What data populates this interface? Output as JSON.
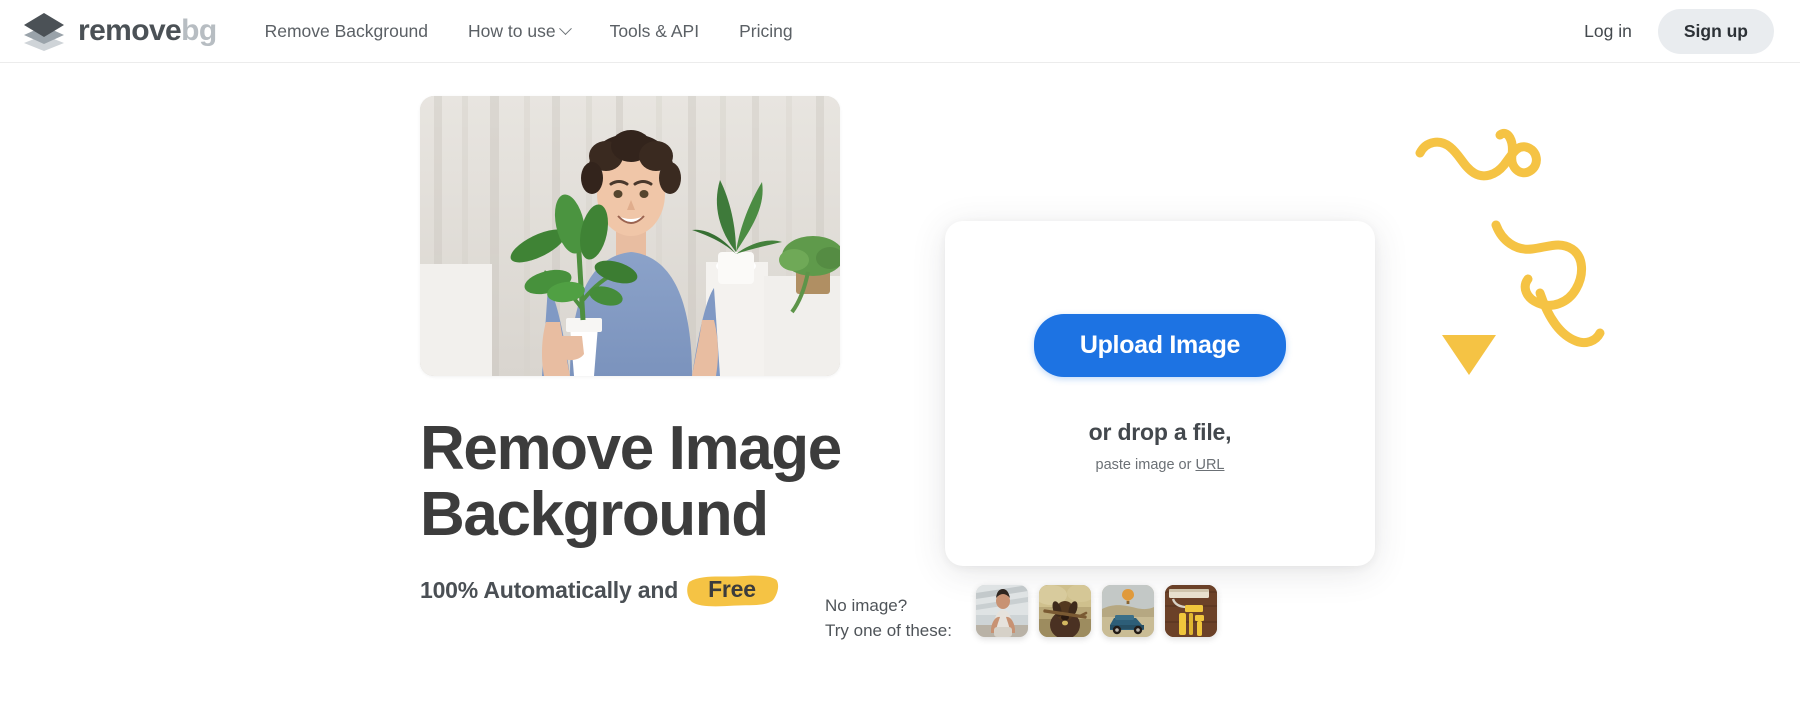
{
  "brand": {
    "name_primary": "remove",
    "name_secondary": "bg",
    "logo_icon": "stacked-layers-diamond-icon"
  },
  "header": {
    "nav": [
      {
        "label": "Remove Background",
        "has_dropdown": false
      },
      {
        "label": "How to use",
        "has_dropdown": true,
        "dropdown_icon": "chevron-down-icon"
      },
      {
        "label": "Tools & API",
        "has_dropdown": false
      },
      {
        "label": "Pricing",
        "has_dropdown": false
      }
    ],
    "login_label": "Log in",
    "signup_label": "Sign up"
  },
  "hero": {
    "photo_alt": "man-with-curly-hair-holding-potted-plant",
    "title_line1": "Remove Image",
    "title_line2": "Background",
    "subtitle_prefix": "100% Automatically and",
    "subtitle_highlight": "Free"
  },
  "upload": {
    "button_label": "Upload Image",
    "drop_text": "or drop a file,",
    "paste_prefix": "paste image or ",
    "paste_link": "URL"
  },
  "samples": {
    "label_line1": "No image?",
    "label_line2": "Try one of these:",
    "thumbnails": [
      {
        "name": "sample-man-sitting",
        "alt": "young man sitting with arms around knees"
      },
      {
        "name": "sample-dog-stick",
        "alt": "brown dog carrying a stick"
      },
      {
        "name": "sample-car-balloon",
        "alt": "blue classic car with hot air balloon"
      },
      {
        "name": "sample-paint-rollers",
        "alt": "yellow paint rollers on wood"
      }
    ]
  },
  "decoration": {
    "squiggle_icon": "yellow-squiggle-line",
    "triangle_icon": "yellow-triangle-down"
  },
  "colors": {
    "accent_blue": "#1d73e3",
    "accent_yellow": "#f5c344",
    "heading_gray": "#3c3c3c",
    "nav_gray": "#5b6065",
    "signup_bg": "#e9ecef"
  }
}
